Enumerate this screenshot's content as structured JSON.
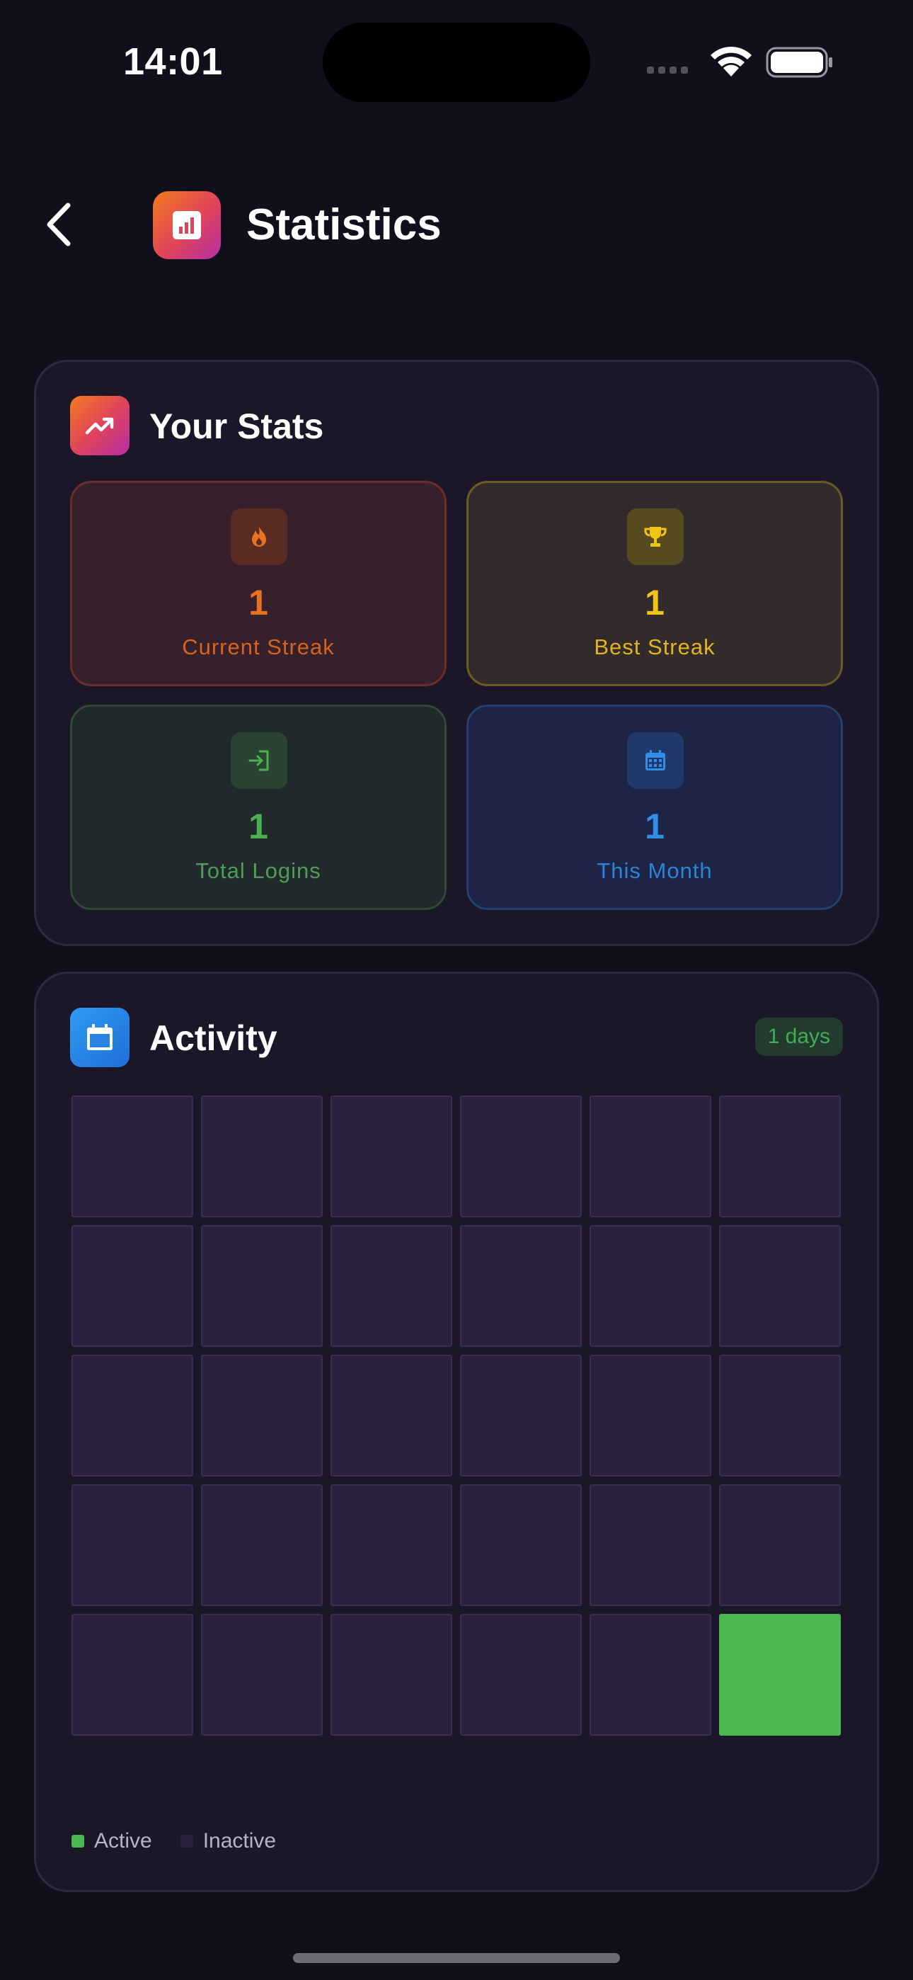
{
  "status_bar": {
    "time": "14:01"
  },
  "header": {
    "title": "Statistics",
    "back_icon": "chevron-left-icon",
    "app_icon": "bar-chart-icon"
  },
  "stats": {
    "title": "Your Stats",
    "icon": "trending-up-icon",
    "tiles": [
      {
        "value": "1",
        "label": "Current Streak",
        "icon": "flame-icon",
        "color": "#e8731f"
      },
      {
        "value": "1",
        "label": "Best Streak",
        "icon": "trophy-icon",
        "color": "#f0c419"
      },
      {
        "value": "1",
        "label": "Total Logins",
        "icon": "login-icon",
        "color": "#4caf50"
      },
      {
        "value": "1",
        "label": "This Month",
        "icon": "calendar-icon",
        "color": "#2f8fe8"
      }
    ]
  },
  "activity": {
    "title": "Activity",
    "icon": "calendar-icon",
    "badge": "1 days",
    "grid": {
      "columns": 6,
      "rows": 5,
      "active_cells": [
        29
      ]
    },
    "legend": {
      "active_label": "Active",
      "inactive_label": "Inactive",
      "active_color": "#4cb750",
      "inactive_color": "#2a2140"
    }
  }
}
